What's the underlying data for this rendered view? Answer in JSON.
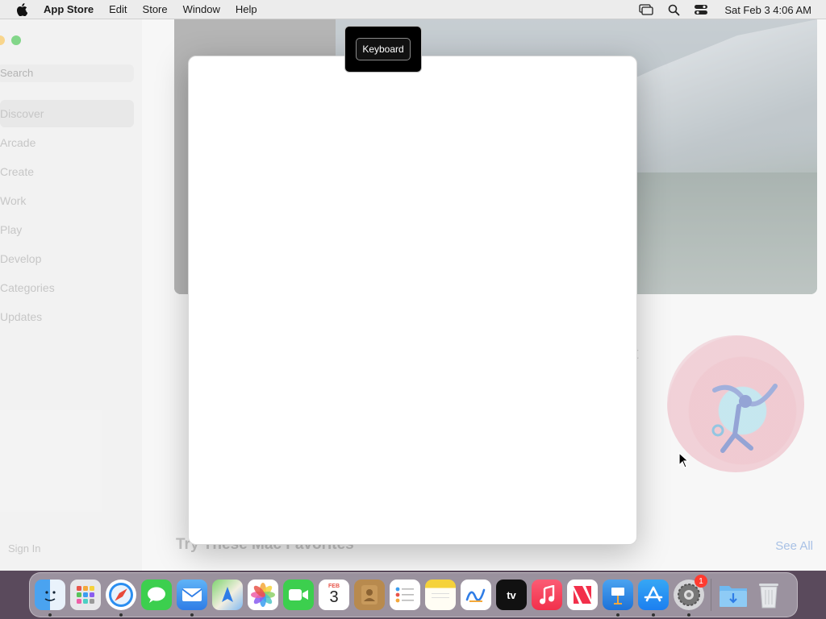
{
  "menubar": {
    "app_name": "App Store",
    "items": [
      "Edit",
      "Store",
      "Window",
      "Help"
    ],
    "clock": "Sat Feb 3  4:06 AM"
  },
  "sidebar": {
    "search_placeholder": "Search",
    "items": [
      {
        "label": "Discover",
        "active": true
      },
      {
        "label": "Arcade"
      },
      {
        "label": "Create"
      },
      {
        "label": "Work"
      },
      {
        "label": "Play"
      },
      {
        "label": "Develop"
      },
      {
        "label": "Categories"
      },
      {
        "label": "Updates"
      }
    ],
    "sign_in": "Sign In"
  },
  "main": {
    "section_title": "Try These Mac Favorites",
    "see_all": "See All",
    "partial_text": "t"
  },
  "tooltip": {
    "label": "Keyboard"
  },
  "dock": {
    "calendar_month": "FEB",
    "calendar_day": "3",
    "tv_label": "tv",
    "settings_badge": "1",
    "apps": [
      "finder",
      "launchpad",
      "safari",
      "messages",
      "mail",
      "maps",
      "photos",
      "facetime",
      "calendar",
      "contacts",
      "reminders",
      "notes",
      "freeform",
      "tv",
      "music",
      "news",
      "keynote",
      "app-store",
      "system-settings",
      "downloads",
      "trash"
    ]
  },
  "colors": {
    "accent": "#7aa0d8",
    "traffic_yellow": "#f5bf4f",
    "traffic_green": "#3fc04a"
  }
}
